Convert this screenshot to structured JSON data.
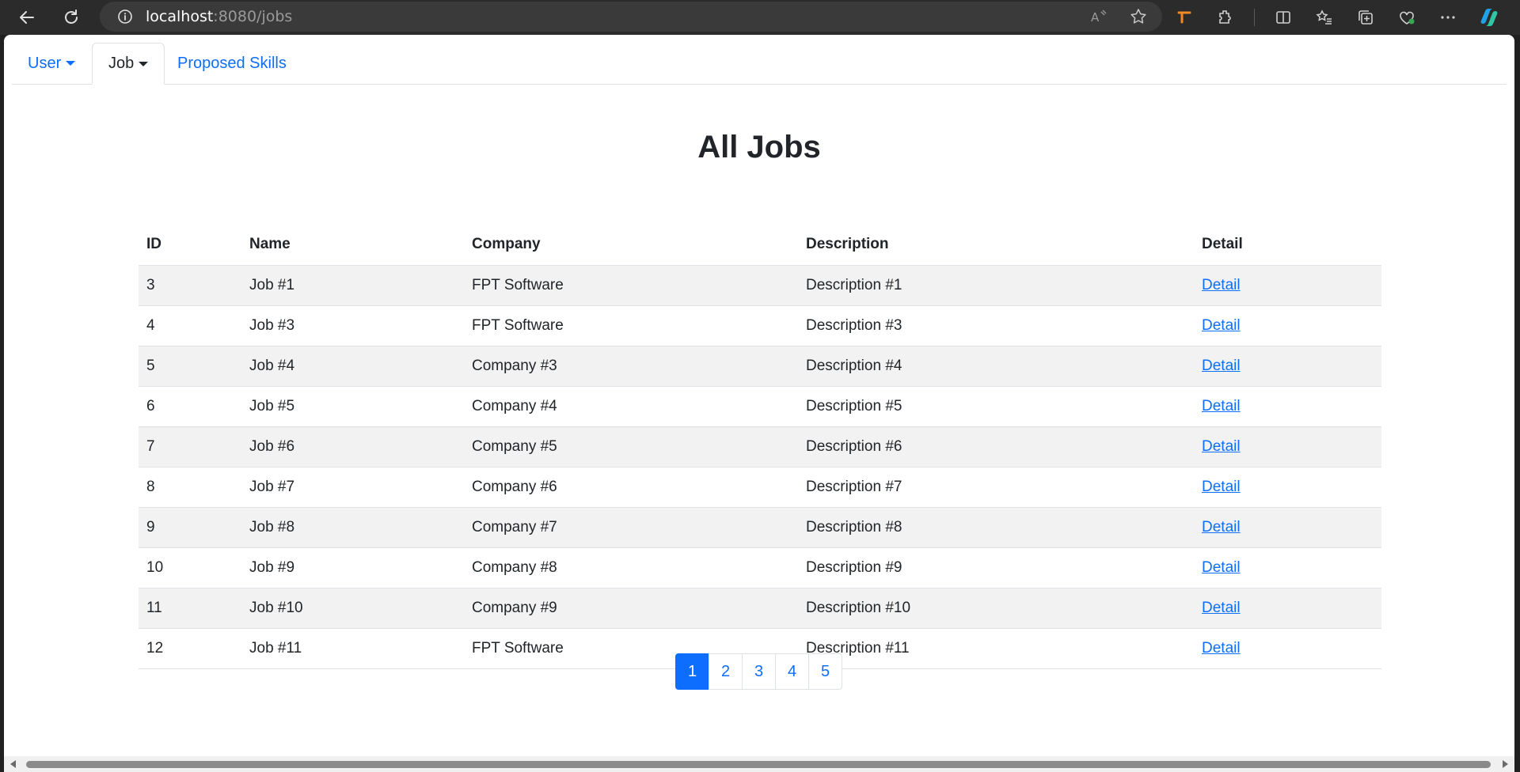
{
  "browser": {
    "url_host": "localhost",
    "url_rest": ":8080/jobs"
  },
  "nav": {
    "tabs": [
      {
        "label": "User",
        "dropdown": true,
        "active": false
      },
      {
        "label": "Job",
        "dropdown": true,
        "active": true
      },
      {
        "label": "Proposed Skills",
        "dropdown": false,
        "active": false
      }
    ]
  },
  "page": {
    "title": "All Jobs"
  },
  "table": {
    "headers": [
      "ID",
      "Name",
      "Company",
      "Description",
      "Detail"
    ],
    "rows": [
      {
        "id": "3",
        "name": "Job #1",
        "company": "FPT Software",
        "description": "Description #1",
        "detail": "Detail"
      },
      {
        "id": "4",
        "name": "Job #3",
        "company": "FPT Software",
        "description": "Description #3",
        "detail": "Detail"
      },
      {
        "id": "5",
        "name": "Job #4",
        "company": "Company #3",
        "description": "Description #4",
        "detail": "Detail"
      },
      {
        "id": "6",
        "name": "Job #5",
        "company": "Company #4",
        "description": "Description #5",
        "detail": "Detail"
      },
      {
        "id": "7",
        "name": "Job #6",
        "company": "Company #5",
        "description": "Description #6",
        "detail": "Detail"
      },
      {
        "id": "8",
        "name": "Job #7",
        "company": "Company #6",
        "description": "Description #7",
        "detail": "Detail"
      },
      {
        "id": "9",
        "name": "Job #8",
        "company": "Company #7",
        "description": "Description #8",
        "detail": "Detail"
      },
      {
        "id": "10",
        "name": "Job #9",
        "company": "Company #8",
        "description": "Description #9",
        "detail": "Detail"
      },
      {
        "id": "11",
        "name": "Job #10",
        "company": "Company #9",
        "description": "Description #10",
        "detail": "Detail"
      },
      {
        "id": "12",
        "name": "Job #11",
        "company": "FPT Software",
        "description": "Description #11",
        "detail": "Detail"
      }
    ]
  },
  "pagination": {
    "pages": [
      "1",
      "2",
      "3",
      "4",
      "5"
    ],
    "current": "1"
  },
  "colors": {
    "primary": "#0d6efd",
    "stripe": "#f2f2f2",
    "border": "#dee2e6",
    "chrome": "#2b2b2b"
  }
}
